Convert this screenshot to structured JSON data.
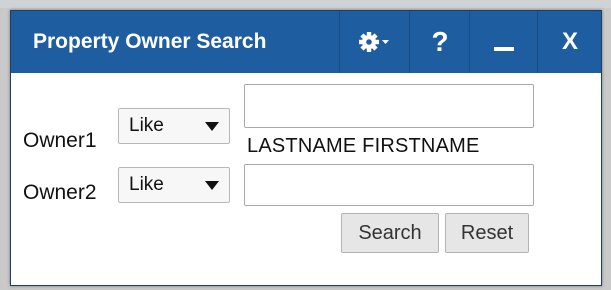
{
  "window": {
    "title": "Property Owner Search",
    "help_label": "?",
    "close_label": "X"
  },
  "form": {
    "owner1": {
      "label": "Owner1",
      "operator": "Like",
      "value": "",
      "hint": "LASTNAME FIRSTNAME"
    },
    "owner2": {
      "label": "Owner2",
      "operator": "Like",
      "value": ""
    }
  },
  "actions": {
    "search_label": "Search",
    "reset_label": "Reset"
  },
  "colors": {
    "titlebar": "#1f5da1",
    "titlebar_text": "#ffffff"
  },
  "icons": {
    "settings": "gear-icon",
    "settings_dropdown": "caret-down-icon",
    "minimize": "minimize-icon",
    "select_caret": "caret-down-icon"
  }
}
